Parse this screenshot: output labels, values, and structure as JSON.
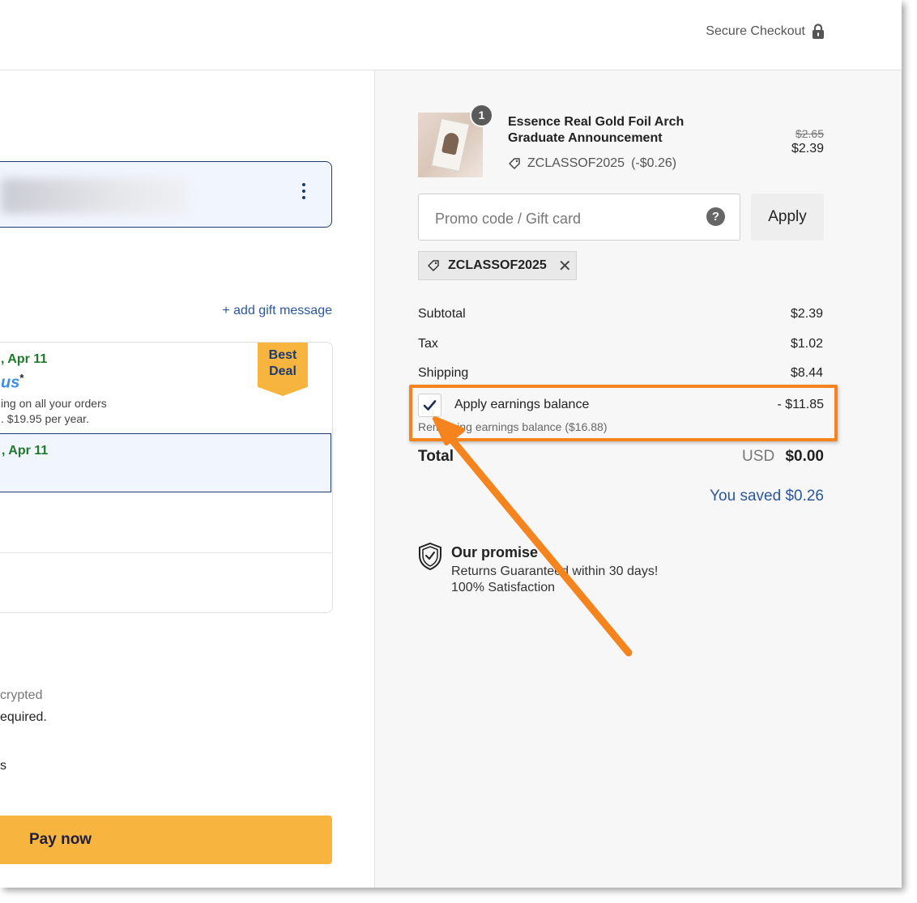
{
  "header": {
    "secure_label": "Secure Checkout",
    "lock_icon": "lock-icon"
  },
  "left": {
    "gift_link": "+ add gift message",
    "shipping_options": [
      {
        "date": ", Apr 11",
        "brand": "us",
        "brand_sup": "*",
        "line1": "ing on all your orders",
        "line2": ". $19.95 per year.",
        "badge": [
          "Best",
          "Deal"
        ]
      },
      {
        "date": ", Apr 11"
      }
    ],
    "encrypted_text": "crypted",
    "required_text": "equired.",
    "s_text": "s",
    "pay_button": "Pay now"
  },
  "cart": {
    "quantity": "1",
    "product_name": "Essence Real Gold Foil Arch Graduate Announcement",
    "product_code": "ZCLASSOF2025",
    "product_discount": "(-$0.26)",
    "old_price": "$2.65",
    "new_price": "$2.39"
  },
  "promo": {
    "placeholder": "Promo code / Gift card",
    "help": "?",
    "apply_label": "Apply",
    "applied_code": "ZCLASSOF2025",
    "remove_symbol": "✕"
  },
  "summary": {
    "subtotal_label": "Subtotal",
    "subtotal_value": "$2.39",
    "tax_label": "Tax",
    "tax_value": "$1.02",
    "shipping_label": "Shipping",
    "shipping_value": "$8.44",
    "earnings_label": "Apply earnings balance",
    "earnings_value": "- $11.85",
    "earnings_checked": true,
    "remaining_label": "Remaining earnings balance ($16.88)",
    "total_label": "Total",
    "currency": "USD",
    "total_value": "$0.00",
    "saved_label": "You saved $0.26"
  },
  "promise": {
    "title": "Our promise",
    "line1": "Returns Guaranteed within 30 days!",
    "line2": "100% Satisfaction"
  },
  "colors": {
    "accent": "#f7b53f",
    "link": "#2b579a",
    "highlight": "#f5841f",
    "green": "#1f7a2c"
  }
}
